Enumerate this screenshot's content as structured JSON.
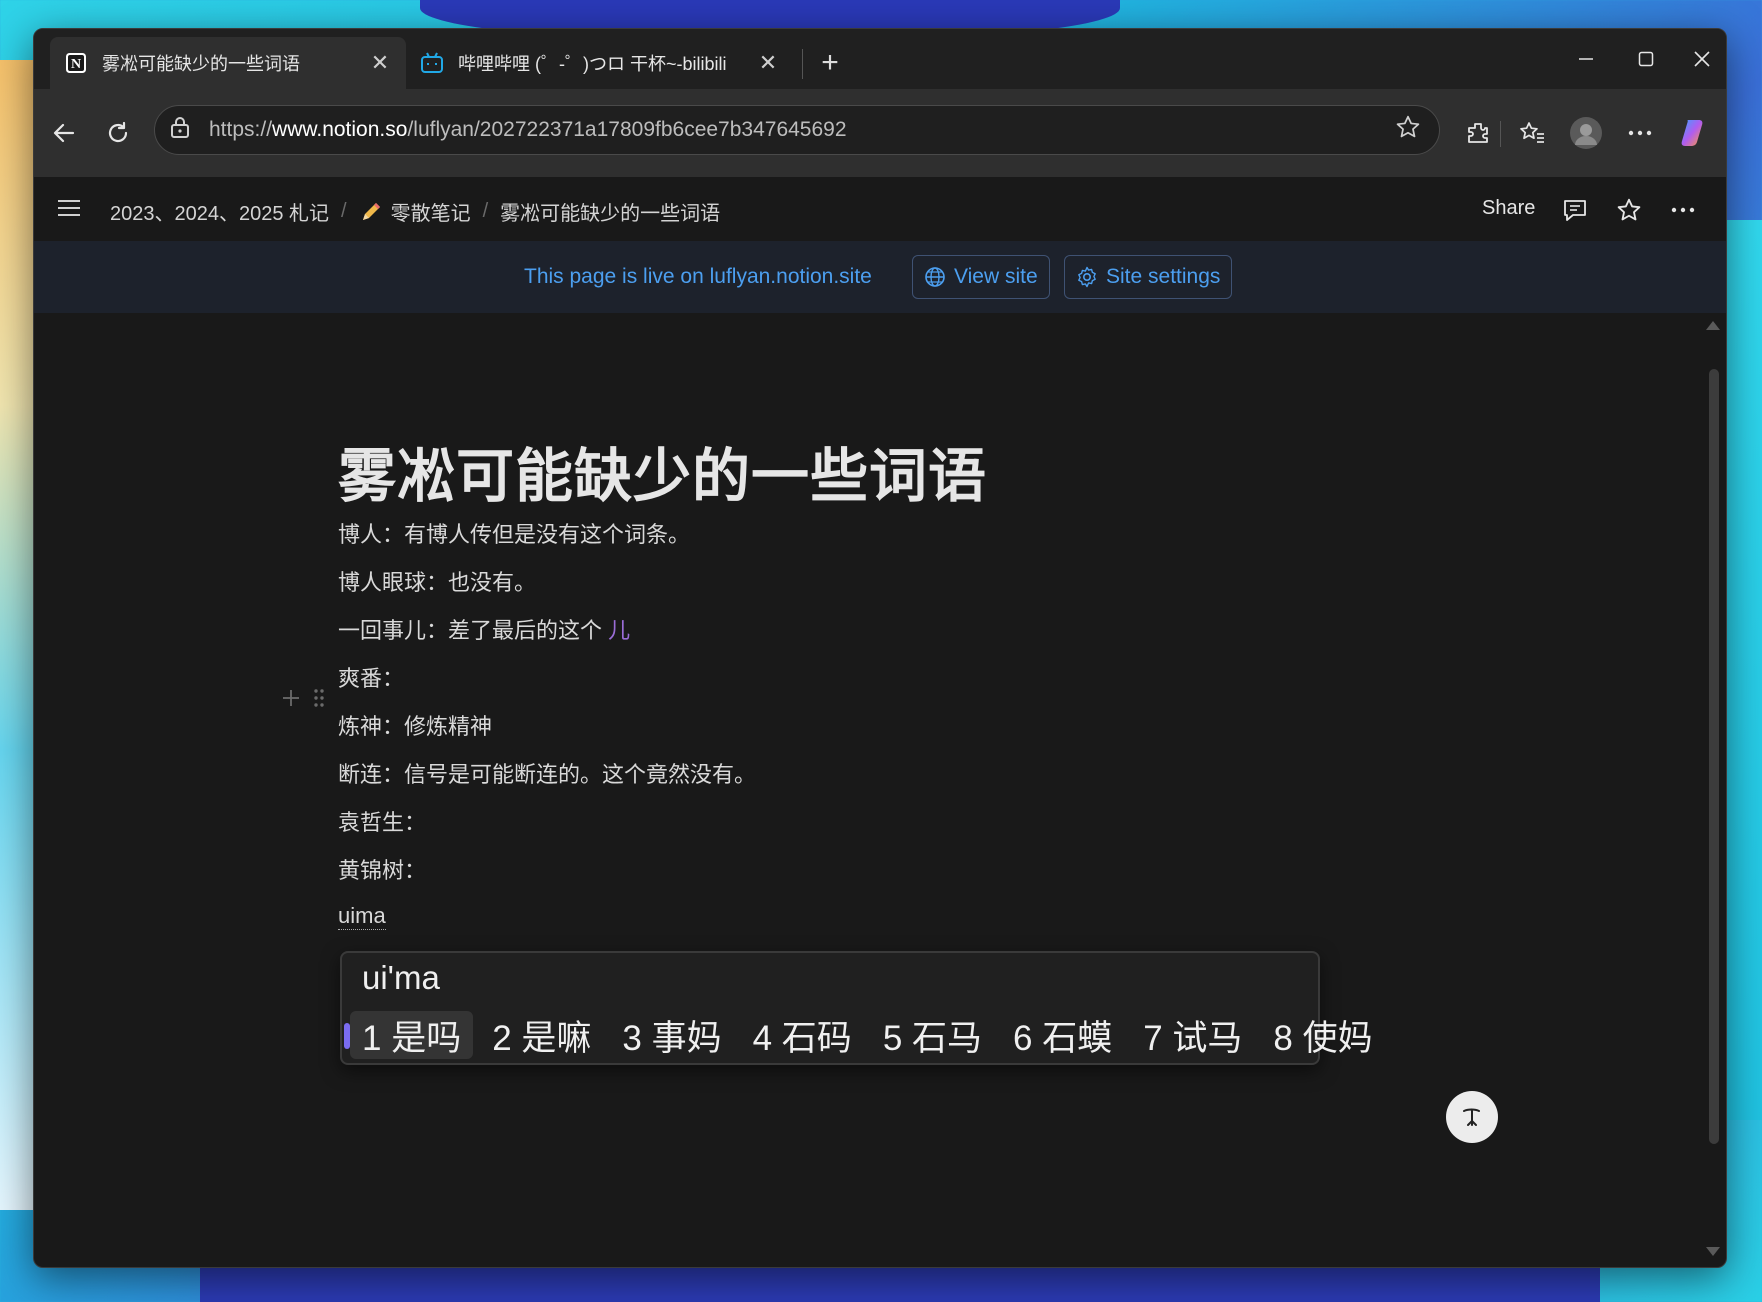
{
  "tabs": [
    {
      "title": "雾凇可能缺少的一些词语",
      "icon": "notion-icon",
      "active": true
    },
    {
      "title": "哔哩哔哩 (゜-゜)つロ 干杯~-bilibili",
      "icon": "bilibili-icon",
      "active": false
    }
  ],
  "address_bar": {
    "url_prefix": "https://",
    "url_host": "www.notion.so",
    "url_path": "/luflyan/202722371a17809fb6cee7b347645692"
  },
  "breadcrumb": {
    "items": [
      "2023、2024、2025 札记",
      "零散笔记",
      "雾凇可能缺少的一些词语"
    ],
    "separator": "/",
    "emoji": "✏️"
  },
  "topbar": {
    "share_label": "Share"
  },
  "banner": {
    "text": "This page is live on luflyan.notion.site",
    "view_site": "View site",
    "site_settings": "Site settings"
  },
  "page": {
    "title": "雾凇可能缺少的一些词语",
    "lines": [
      "博人：有博人传但是没有这个词条。",
      "博人眼球：也没有。",
      "一回事儿：差了最后的这个",
      "爽番：",
      "炼神：修炼精神",
      "断连：信号是可能断连的。这个竟然没有。",
      "袁哲生：",
      "黄锦树："
    ],
    "line3_highlight": "儿",
    "typing": "uima"
  },
  "ime": {
    "composition": "ui'ma",
    "candidates": [
      "1 是吗",
      "2 是嘛",
      "3 事妈",
      "4 石码",
      "5 石马",
      "6 石蟆",
      "7 试马",
      "8 使妈"
    ],
    "selected_index": 0
  },
  "colors": {
    "accent_blue": "#4c9ff0",
    "highlight_purple": "#9a6dd7",
    "ime_indicator": "#7a6cf0"
  }
}
